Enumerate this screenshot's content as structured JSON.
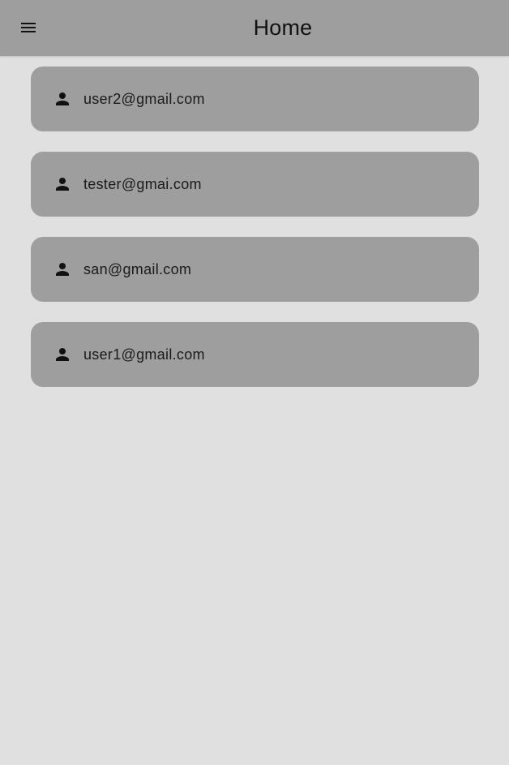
{
  "app_bar": {
    "title": "Home",
    "menu_icon": "hamburger-menu-icon"
  },
  "users": [
    {
      "email": "user2@gmail.com",
      "icon": "person-icon"
    },
    {
      "email": "tester@gmai.com",
      "icon": "person-icon"
    },
    {
      "email": "san@gmail.com",
      "icon": "person-icon"
    },
    {
      "email": "user1@gmail.com",
      "icon": "person-icon"
    }
  ],
  "colors": {
    "background": "#e0e0e0",
    "app_bar": "#9e9e9e",
    "card": "#9e9e9e",
    "text": "#111111"
  }
}
